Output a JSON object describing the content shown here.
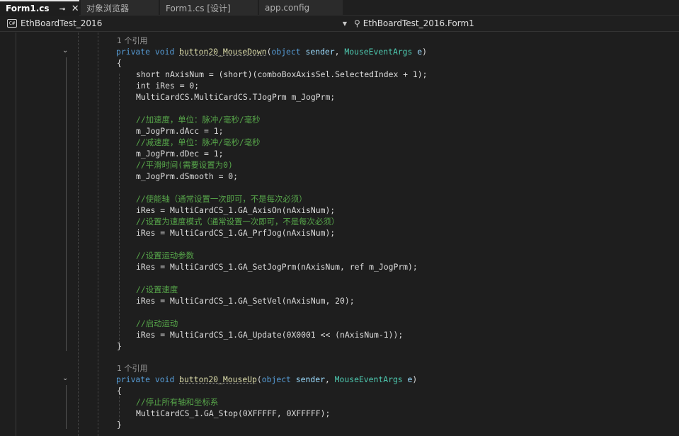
{
  "tabs": [
    {
      "label": "Form1.cs",
      "active": true,
      "pin": "⊸",
      "close": "✕"
    },
    {
      "label": "对象浏览器"
    },
    {
      "label": "Form1.cs [设计]"
    },
    {
      "label": "app.config"
    }
  ],
  "navbar": {
    "project": "EthBoardTest_2016",
    "project_icon": "C#",
    "class": "EthBoardTest_2016.Form1"
  },
  "code": {
    "ref1": "1 个引用",
    "m1_sig": [
      "private",
      "void",
      "button20_MouseDown",
      "object",
      "sender",
      "MouseEventArgs",
      "e"
    ],
    "l_short": "short nAxisNum = (short)(comboBoxAxisSel.SelectedIndex + 1);",
    "l_int": "int iRes = 0;",
    "l_jog": "MultiCardCS.MultiCardCS.TJogPrm m_JogPrm;",
    "c_acc": "//加速度，单位：脉冲/毫秒/毫秒",
    "l_acc": "m_JogPrm.dAcc = 1;",
    "c_dec": "//减速度，单位：脉冲/毫秒/毫秒",
    "l_dec": "m_JogPrm.dDec = 1;",
    "c_smooth": "//平滑时间(需要设置为0)",
    "l_smooth": "m_JogPrm.dSmooth = 0;",
    "c_enable": "//使能轴（通常设置一次即可，不是每次必须）",
    "l_axison": "iRes = MultiCardCS_1.GA_AxisOn(nAxisNum);",
    "c_speedmode": "//设置为速度模式（通常设置一次即可，不是每次必须）",
    "l_prfjog": "iRes = MultiCardCS_1.GA_PrfJog(nAxisNum);",
    "c_params": "//设置运动参数",
    "l_setjog": "iRes = MultiCardCS_1.GA_SetJogPrm(nAxisNum, ref m_JogPrm);",
    "c_vel": "//设置速度",
    "l_setvel": "iRes = MultiCardCS_1.GA_SetVel(nAxisNum, 20);",
    "c_start": "//启动运动",
    "l_update": "iRes = MultiCardCS_1.GA_Update(0X0001 << (nAxisNum-1));",
    "ref2": "1 个引用",
    "c_stop": "//停止所有轴和坐标系",
    "l_stop": "MultiCardCS_1.GA_Stop(0XFFFFF, 0XFFFFF);"
  },
  "colors": {
    "background": "#1e1e1e",
    "keyword": "#569cd6",
    "type": "#4ec9b0",
    "method": "#dcdcaa",
    "comment": "#57a64a",
    "variable": "#9cdcfe",
    "number": "#b5cea8"
  }
}
